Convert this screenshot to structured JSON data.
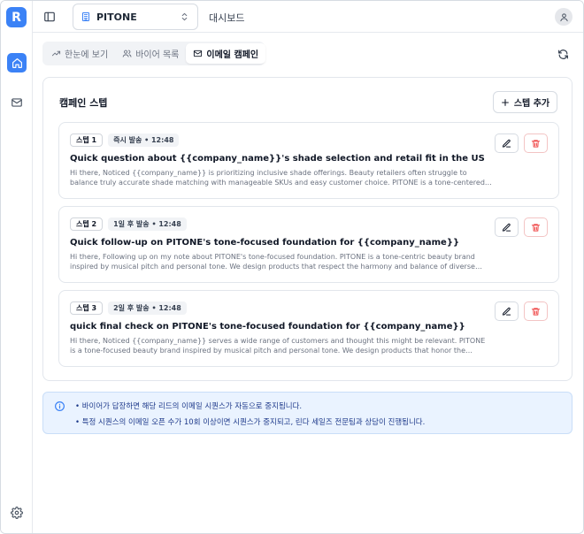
{
  "app": {
    "logo_letter": "R"
  },
  "topbar": {
    "org_name": "PITONE",
    "page_label": "대시보드"
  },
  "tabs": [
    {
      "label": "한눈에 보기",
      "icon": "trend-icon",
      "active": false
    },
    {
      "label": "바이어 목록",
      "icon": "users-icon",
      "active": false
    },
    {
      "label": "이메일 캠페인",
      "icon": "mail-icon",
      "active": true
    }
  ],
  "campaign": {
    "title": "캠페인 스텝",
    "add_step_label": "스텝 추가",
    "steps": [
      {
        "step_label": "스텝 1",
        "timing": "즉시 발송 • 12:48",
        "subject": "Quick question about {{company_name}}'s shade selection and retail fit in the US",
        "preview": "Hi there, Noticed {{company_name}} is prioritizing inclusive shade offerings. Beauty retailers often struggle to balance truly accurate shade matching with manageable SKUs and easy customer choice. PITONE is a tone-centered beauty brand..."
      },
      {
        "step_label": "스텝 2",
        "timing": "1일 후 발송 • 12:48",
        "subject": "Quick follow-up on PITONE's tone-focused foundation for {{company_name}}",
        "preview": "Hi there, Following up on my note about PITONE's tone-focused foundation. PITONE is a tone-centric beauty brand inspired by musical pitch and personal tone. We design products that respect the harmony and balance of diverse skin..."
      },
      {
        "step_label": "스텝 3",
        "timing": "2일 후 발송 • 12:48",
        "subject": "quick final check on PITONE's tone-focused foundation for {{company_name}}",
        "preview": "Hi there, Noticed {{company_name}} serves a wide range of customers and thought this might be relevant. PITONE is a tone-focused beauty brand inspired by musical pitch and personal tone. We design products that honor the harmony and..."
      }
    ]
  },
  "notice": {
    "lines": [
      "• 바이어가 답장하면 해당 리드의 이메일 시퀀스가 자동으로 중지됩니다.",
      "• 특정 시퀀스의 이메일 오픈 수가 10회 이상이면 시퀀스가 중지되고, 린다 세일즈 전문팀과 상담이 진행됩니다."
    ]
  },
  "colors": {
    "accent": "#3b82f6",
    "danger": "#ef4444",
    "notice_bg": "#eaf3ff"
  }
}
